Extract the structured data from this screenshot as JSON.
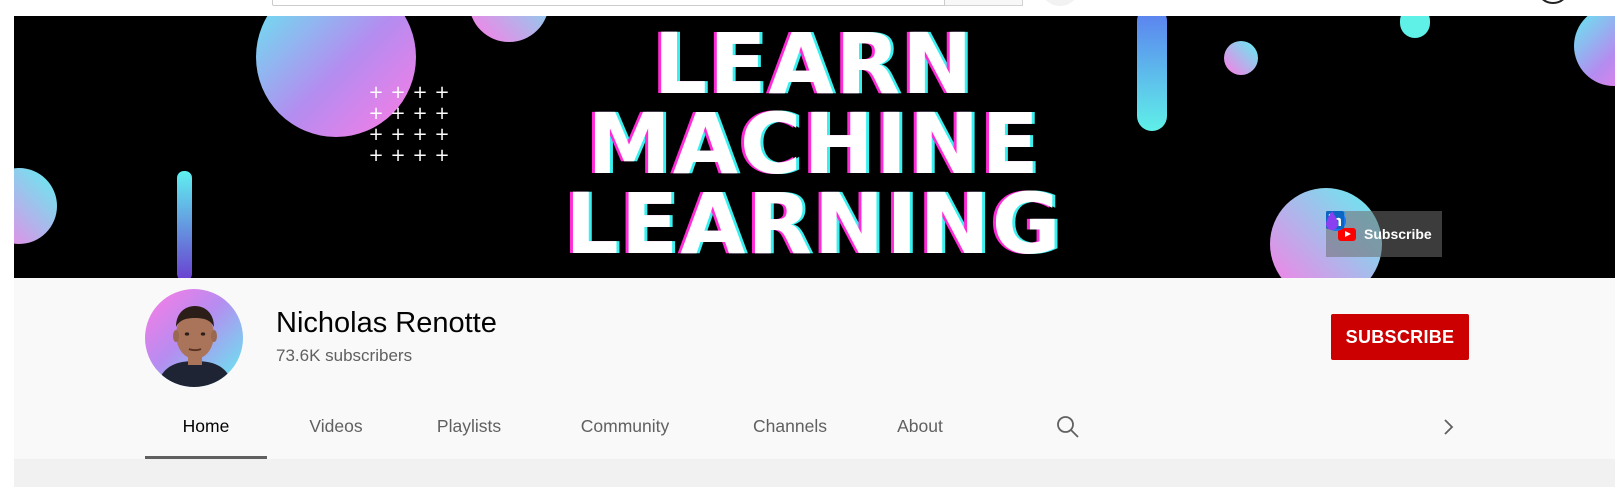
{
  "banner": {
    "headline": [
      "LEARN",
      "MACHINE",
      "LEARNING"
    ],
    "links": {
      "subscribe_label": "Subscribe",
      "social_icons": [
        "twitter-icon",
        "facebook-icon",
        "linkedin-icon",
        "drop-icon"
      ]
    }
  },
  "channel": {
    "name": "Nicholas Renotte",
    "subscribers": "73.6K subscribers",
    "subscribe_button": "SUBSCRIBE"
  },
  "tabs": [
    {
      "label": "Home",
      "active": true
    },
    {
      "label": "Videos"
    },
    {
      "label": "Playlists"
    },
    {
      "label": "Community"
    },
    {
      "label": "Channels"
    },
    {
      "label": "About"
    }
  ],
  "icons": {
    "search": "search-icon",
    "next": "chevron-right-icon"
  },
  "colors": {
    "subscribe_red": "#cc0000",
    "banner_bg": "#000000",
    "accent_pink": "#ff2bd6",
    "accent_cyan": "#39f0f0",
    "twitter": "#1d9bf0",
    "facebook": "#1877f2",
    "linkedin": "#0a66c2"
  }
}
